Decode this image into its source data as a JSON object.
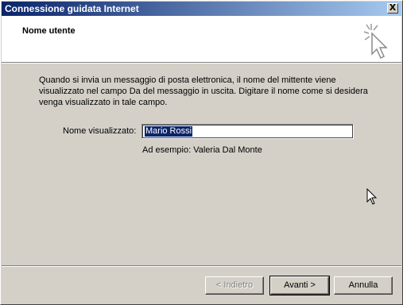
{
  "window": {
    "title": "Connessione guidata Internet",
    "close_symbol": "X"
  },
  "header": {
    "title": "Nome utente",
    "icon": "wizard-cursor-icon"
  },
  "body": {
    "description": "Quando si invia un messaggio di posta elettronica, il nome del mittente viene visualizzato nel campo Da del messaggio in uscita. Digitare il nome come si desidera venga visualizzato in tale campo.",
    "display_name_label": "Nome visualizzato:",
    "display_name_value": "Mario Rossi",
    "example": "Ad esempio: Valeria Dal Monte"
  },
  "buttons": {
    "back": "< Indietro",
    "next": "Avanti >",
    "cancel": "Annulla"
  },
  "colors": {
    "titlebar": "#0a246a",
    "face": "#d4d0c8"
  }
}
